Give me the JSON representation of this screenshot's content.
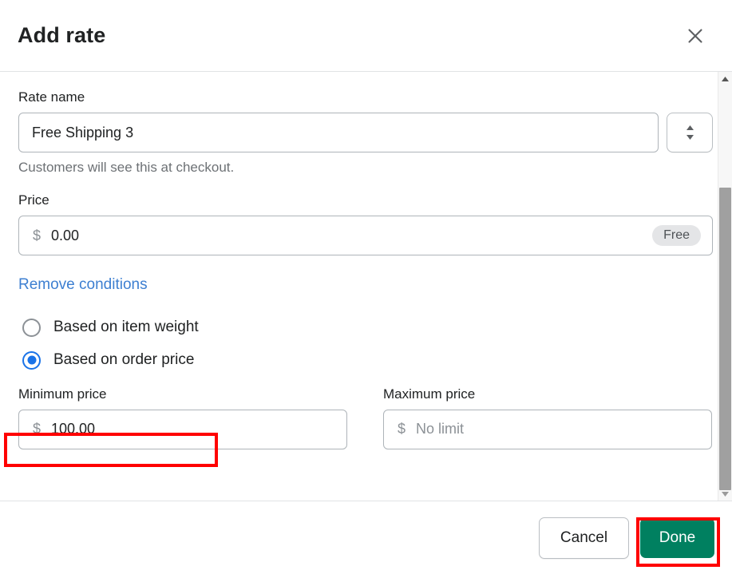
{
  "header": {
    "title": "Add rate",
    "close_icon": "close-icon"
  },
  "form": {
    "rate_name": {
      "label": "Rate name",
      "value": "Free Shipping 3",
      "help_text": "Customers will see this at checkout.",
      "stepper_icon": "up-down-chevron-icon"
    },
    "price": {
      "label": "Price",
      "currency_symbol": "$",
      "value": "0.00",
      "badge": "Free"
    },
    "remove_conditions_link": "Remove conditions",
    "conditions": {
      "options": [
        {
          "label": "Based on item weight",
          "selected": false
        },
        {
          "label": "Based on order price",
          "selected": true
        }
      ]
    },
    "minimum_price": {
      "label": "Minimum price",
      "currency_symbol": "$",
      "value": "100.00",
      "placeholder": ""
    },
    "maximum_price": {
      "label": "Maximum price",
      "currency_symbol": "$",
      "value": "",
      "placeholder": "No limit"
    }
  },
  "footer": {
    "cancel_label": "Cancel",
    "done_label": "Done"
  },
  "scrollbar": {
    "up_arrow_icon": "triangle-up-icon",
    "down_arrow_icon": "triangle-down-icon"
  },
  "colors": {
    "primary_action": "#008060",
    "link": "#3d7fd1",
    "radio_selected": "#1a73e8",
    "annotation": "#ff0000"
  }
}
